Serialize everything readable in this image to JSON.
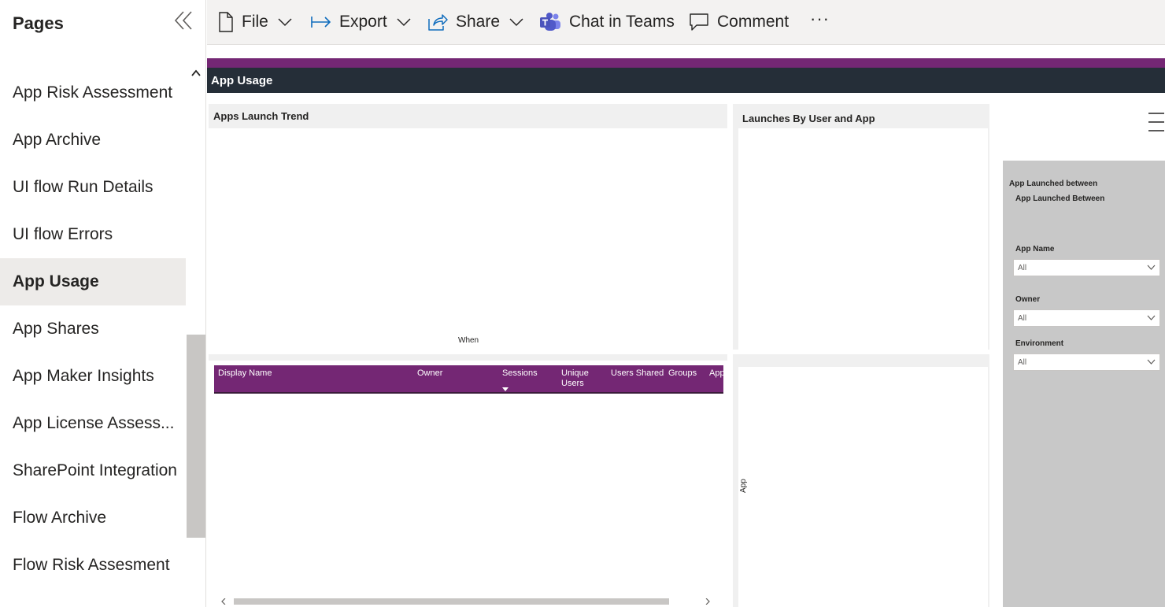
{
  "sidebar": {
    "title": "Pages",
    "items": [
      {
        "label": "App Risk Assessment"
      },
      {
        "label": "App Archive"
      },
      {
        "label": "UI flow Run Details"
      },
      {
        "label": "UI flow Errors"
      },
      {
        "label": "App Usage",
        "active": true
      },
      {
        "label": "App Shares"
      },
      {
        "label": "App Maker Insights"
      },
      {
        "label": "App License Assess..."
      },
      {
        "label": "SharePoint Integration"
      },
      {
        "label": "Flow Archive"
      },
      {
        "label": "Flow Risk Assesment"
      }
    ]
  },
  "toolbar": {
    "file_label": "File",
    "export_label": "Export",
    "share_label": "Share",
    "teams_label": "Chat in Teams",
    "comment_label": "Comment",
    "more_label": "···"
  },
  "report": {
    "page_title": "App Usage",
    "trend": {
      "title": "Apps Launch Trend",
      "xlabel": "When"
    },
    "launches": {
      "title": "Launches By User and App"
    },
    "bottom_chart": {
      "ylabel": "App"
    },
    "table": {
      "columns": [
        "Display Name",
        "Owner",
        "Sessions",
        "Unique Users",
        "Users Shared",
        "Groups",
        "App"
      ],
      "column_lines": [
        [
          "Display Name"
        ],
        [
          "Owner"
        ],
        [
          "Sessions"
        ],
        [
          "Unique",
          "Users"
        ],
        [
          "Users Shared"
        ],
        [
          "Groups"
        ],
        [
          "App"
        ]
      ],
      "sorted_column": "Sessions",
      "rows": []
    },
    "filters": {
      "date_heading": "App Launched between",
      "date_subheading": "App Launched Between",
      "app_name": {
        "label": "App Name",
        "value": "All"
      },
      "owner": {
        "label": "Owner",
        "value": "All"
      },
      "environment": {
        "label": "Environment",
        "value": "All"
      }
    }
  },
  "colors": {
    "accent_purple": "#742774",
    "header_dark": "#252e38",
    "teams_icon": "#5059c9",
    "share_icon": "#0f6cbd"
  }
}
